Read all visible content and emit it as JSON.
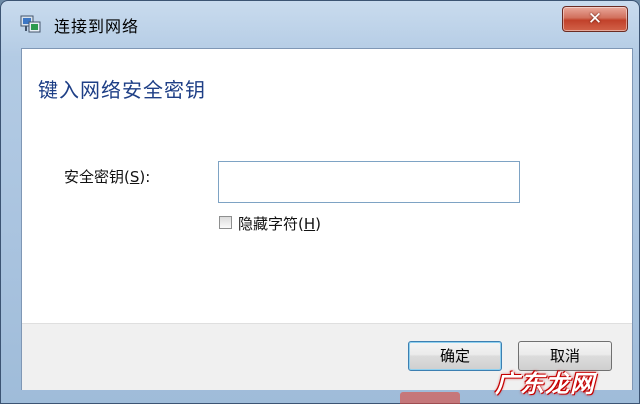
{
  "window": {
    "title": "连接到网络",
    "close_glyph": "✕",
    "app_icon": "network-connect-icon"
  },
  "dialog": {
    "heading": "键入网络安全密钥",
    "key_label_prefix": "安全密钥(",
    "key_label_access": "S",
    "key_label_suffix": "):",
    "key_value": "",
    "hide_chars_checked": false,
    "hide_label_prefix": "隐藏字符(",
    "hide_label_access": "H",
    "hide_label_suffix": ")"
  },
  "buttons": {
    "ok": "确定",
    "cancel": "取消"
  },
  "watermark": "广东龙网"
}
